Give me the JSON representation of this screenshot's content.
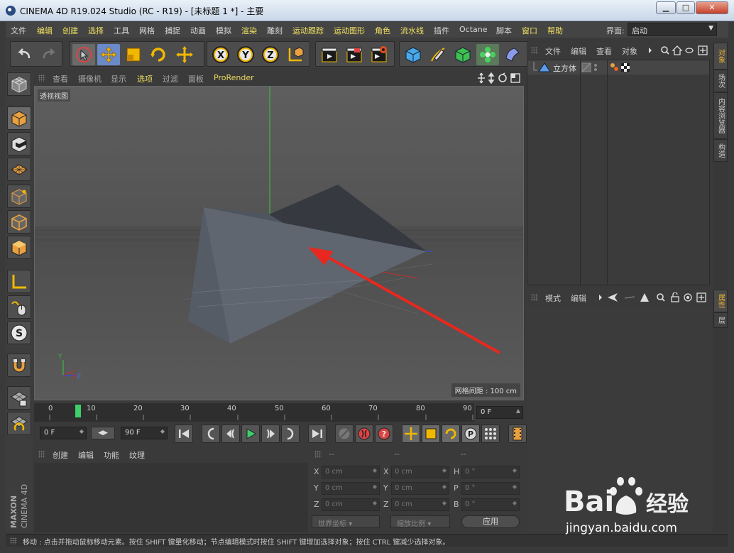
{
  "window": {
    "title": "CINEMA 4D R19.024 Studio (RC - R19) - [未标题 1 *] - 主要",
    "minimize": "▁",
    "maximize": "□",
    "close": "✕"
  },
  "menubar": {
    "items": [
      "文件",
      "编辑",
      "创建",
      "选择",
      "工具",
      "网格",
      "捕捉",
      "动画",
      "模拟",
      "渲染",
      "雕刻",
      "运动跟踪",
      "运动图形",
      "角色",
      "流水线",
      "插件",
      "Octane",
      "脚本",
      "窗口",
      "帮助"
    ],
    "interface_label": "界面:",
    "interface_value": "启动"
  },
  "viewport": {
    "menu": [
      "查看",
      "摄像机",
      "显示",
      "选项",
      "过滤",
      "面板",
      "ProRender"
    ],
    "view_name": "透视视图",
    "grid_spacing": "网格间距 : 100 cm",
    "axis_y": "Y",
    "axis_x": "X",
    "axis_z": "Z"
  },
  "timeline": {
    "ticks": [
      "0",
      "10",
      "20",
      "30",
      "40",
      "50",
      "60",
      "70",
      "80",
      "90"
    ],
    "current_frame": "0 F",
    "start_frame": "0 F",
    "end_frame": "90 F"
  },
  "materials": {
    "menu": [
      "创建",
      "编辑",
      "功能",
      "纹理"
    ]
  },
  "coordinates": {
    "headers": [
      "--",
      "--",
      "--"
    ],
    "rows": [
      {
        "l1": "X",
        "v1": "0 cm",
        "l2": "X",
        "v2": "0 cm",
        "l3": "H",
        "v3": "0 °"
      },
      {
        "l1": "Y",
        "v1": "0 cm",
        "l2": "Y",
        "v2": "0 cm",
        "l3": "P",
        "v3": "0 °"
      },
      {
        "l1": "Z",
        "v1": "0 cm",
        "l2": "Z",
        "v2": "0 cm",
        "l3": "B",
        "v3": "0 °"
      }
    ],
    "world_coords": "世界坐标",
    "scale_ratio": "缩放比例",
    "apply": "应用"
  },
  "object_manager": {
    "menu": [
      "文件",
      "编辑",
      "查看",
      "对象"
    ],
    "objects": [
      {
        "name": "立方体"
      }
    ]
  },
  "attribute_manager": {
    "menu": [
      "模式",
      "编辑"
    ]
  },
  "right_tabs": {
    "top": [
      "对象",
      "场次",
      "内容浏览器",
      "构造"
    ],
    "bottom": [
      "属性",
      "层"
    ]
  },
  "statusbar": {
    "message": "移动 : 点击并拖动鼠标移动元素。按住 SHIFT 键量化移动；节点编辑模式时按住 SHIFT 键增加选择对象；按住 CTRL 键减少选择对象。"
  },
  "branding": {
    "maxon": "MAXON",
    "cinema": "CINEMA 4D"
  },
  "watermark": {
    "brand": "Bai",
    "brand_cn": "经验",
    "url": "jingyan.baidu.com"
  },
  "colors": {
    "accent": "#e8d860",
    "arrow": "#e8281e",
    "timeline_marker": "#3ccf6a",
    "active_tab": "#e8b030"
  }
}
